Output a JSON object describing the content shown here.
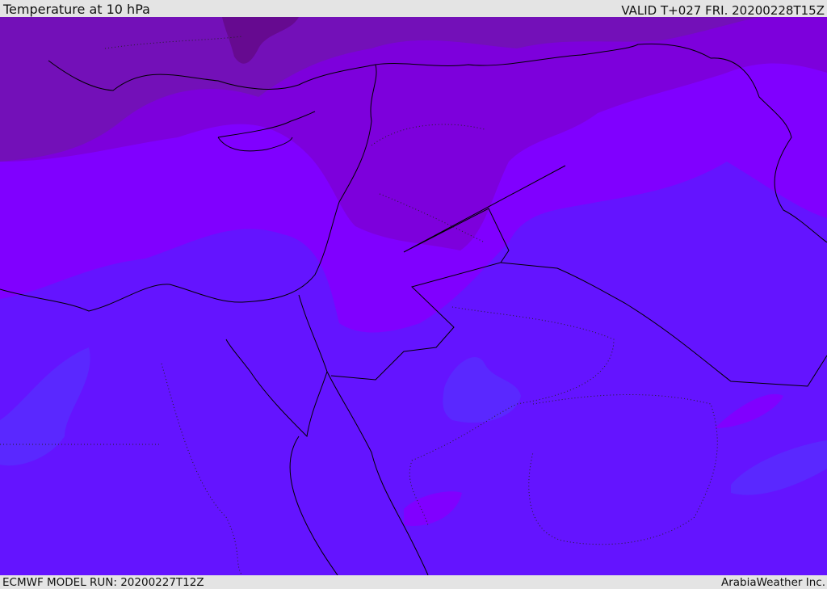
{
  "header": {
    "title": "Temperature at 10 hPa",
    "valid": "VALID T+027 FRI. 20200228T15Z"
  },
  "footer": {
    "model_run": "ECMWF MODEL RUN: 20200227T12Z",
    "brand": "ArabiaWeather Inc."
  },
  "colors": {
    "coldest": "#660a90",
    "cold": "#7310b8",
    "cool": "#7d00dc",
    "mid": "#8000ff",
    "warm": "#6414ff",
    "warm_patch": "#5a28ff"
  }
}
